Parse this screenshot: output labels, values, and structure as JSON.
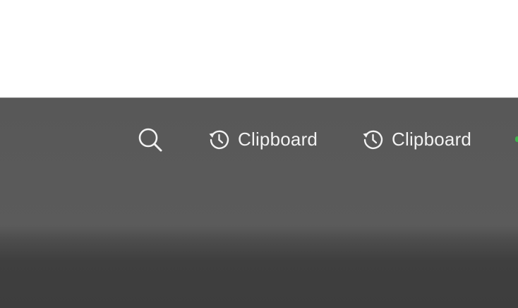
{
  "menubar": {
    "search_icon": "search-icon",
    "items": [
      {
        "icon": "history-icon",
        "label": "Clipboard"
      },
      {
        "icon": "history-icon",
        "label": "Clipboard"
      }
    ],
    "indicator_color": "#3db54a"
  }
}
